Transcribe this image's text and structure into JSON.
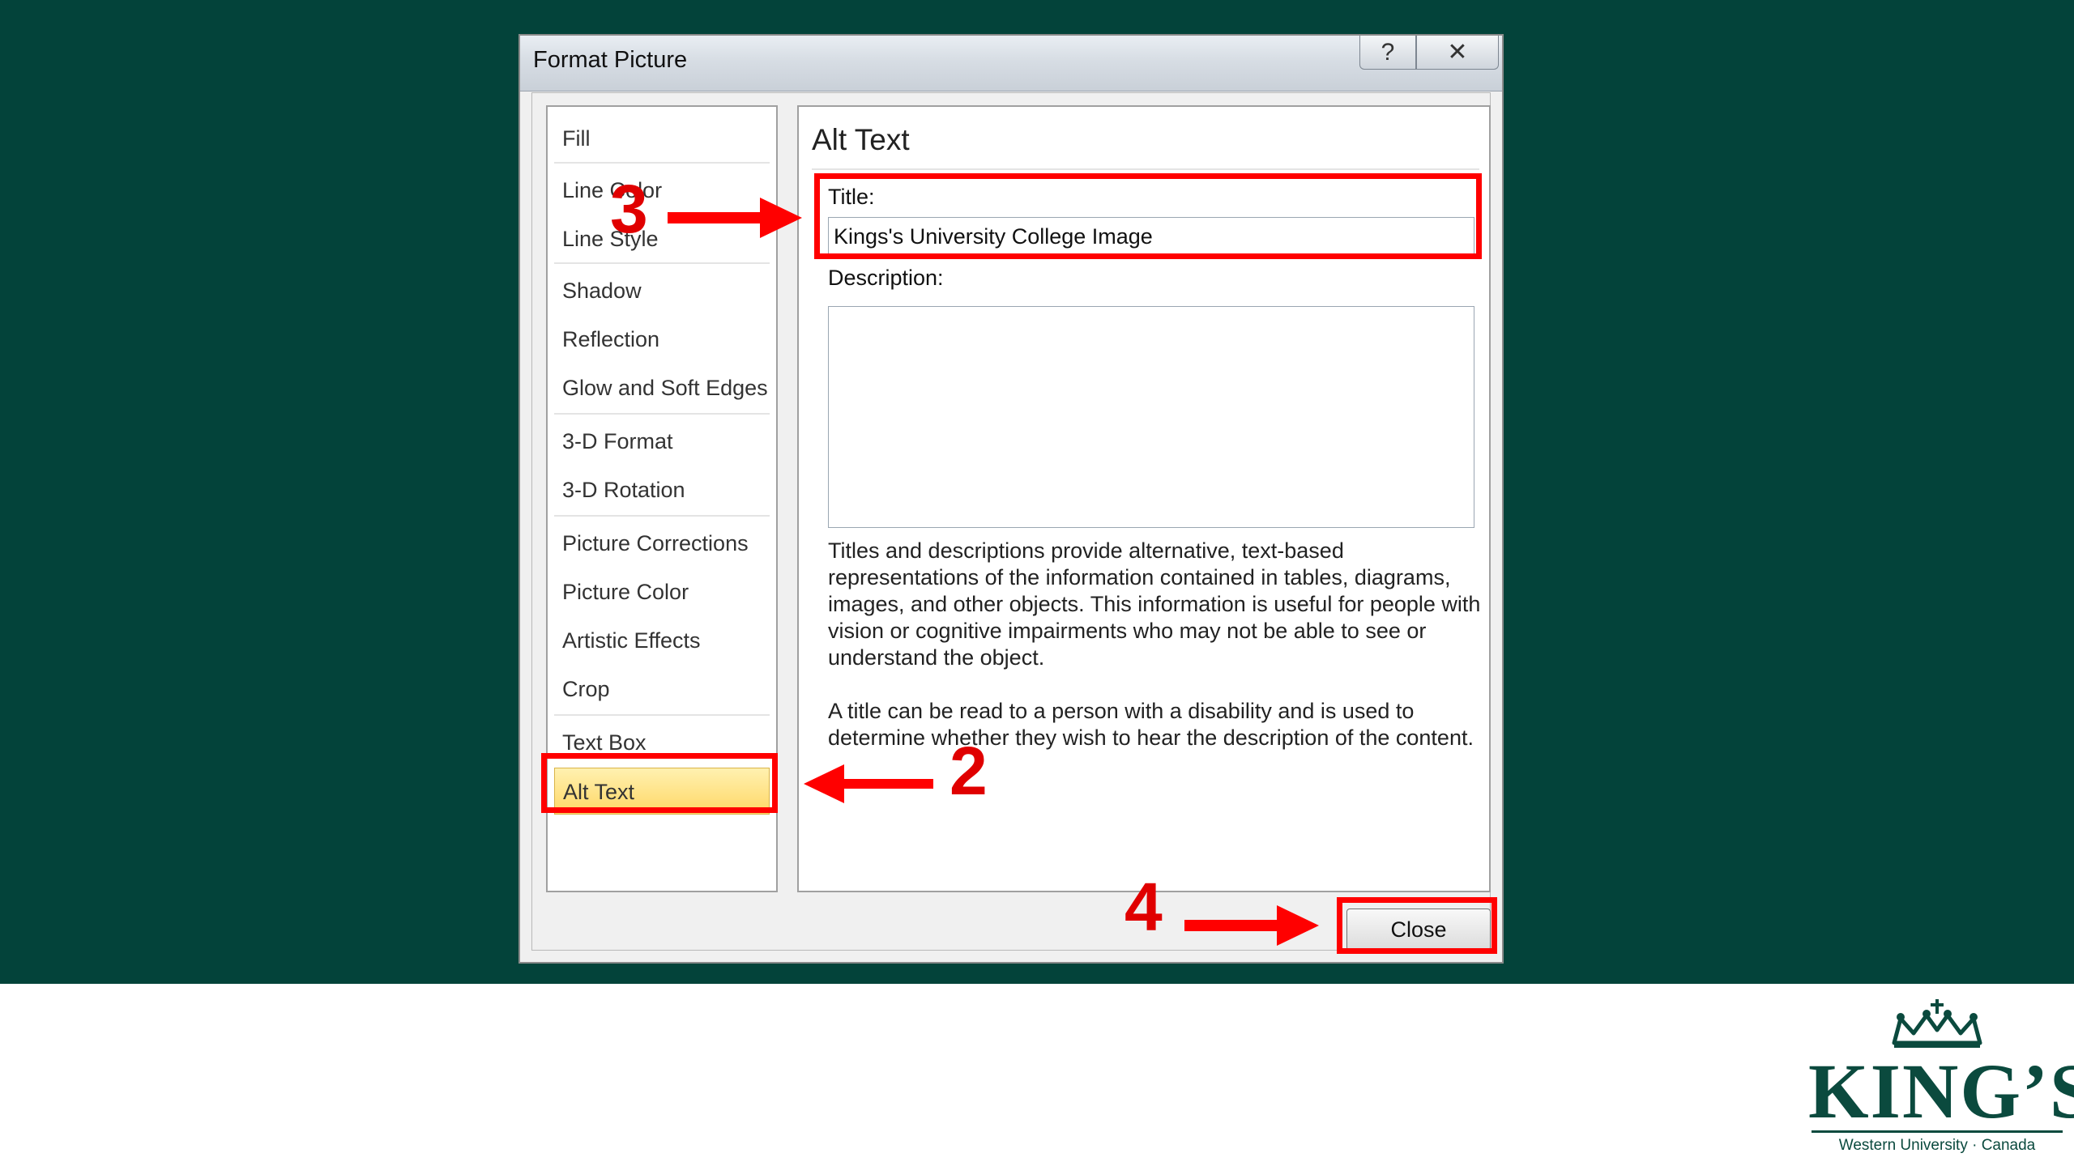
{
  "dialog": {
    "title": "Format Picture",
    "help_glyph": "?",
    "close_glyph": "✕"
  },
  "categories": [
    {
      "label": "Fill"
    },
    {
      "label": "Line Color"
    },
    {
      "label": "Line Style"
    },
    {
      "label": "Shadow"
    },
    {
      "label": "Reflection"
    },
    {
      "label": "Glow and Soft Edges"
    },
    {
      "label": "3-D Format"
    },
    {
      "label": "3-D Rotation"
    },
    {
      "label": "Picture Corrections"
    },
    {
      "label": "Picture Color"
    },
    {
      "label": "Artistic Effects"
    },
    {
      "label": "Crop"
    },
    {
      "label": "Text Box"
    },
    {
      "label": "Alt Text"
    }
  ],
  "selected_category": "Alt Text",
  "panel": {
    "heading": "Alt Text",
    "title_label": "Title:",
    "title_value": "Kings's University College Image",
    "description_label": "Description:",
    "description_value": "",
    "help_paragraph_1": "Titles and descriptions provide alternative, text-based representations of the information contained in tables, diagrams, images, and other objects. This information is useful for people with vision or cognitive impairments who may not be able to see or understand the object.",
    "help_paragraph_2": "A title can be read to a person with a disability and is used to determine whether they wish to hear the description of the content."
  },
  "close_button": "Close",
  "annotations": {
    "step_2": "2",
    "step_3": "3",
    "step_4": "4",
    "highlight_color": "#ff0000"
  },
  "logo": {
    "wordmark": "KING’S",
    "tagline": "Western University · Canada",
    "color": "#0b4a3e"
  },
  "colors": {
    "background_green": "#03433a",
    "selection_yellow": "#ffd766"
  }
}
